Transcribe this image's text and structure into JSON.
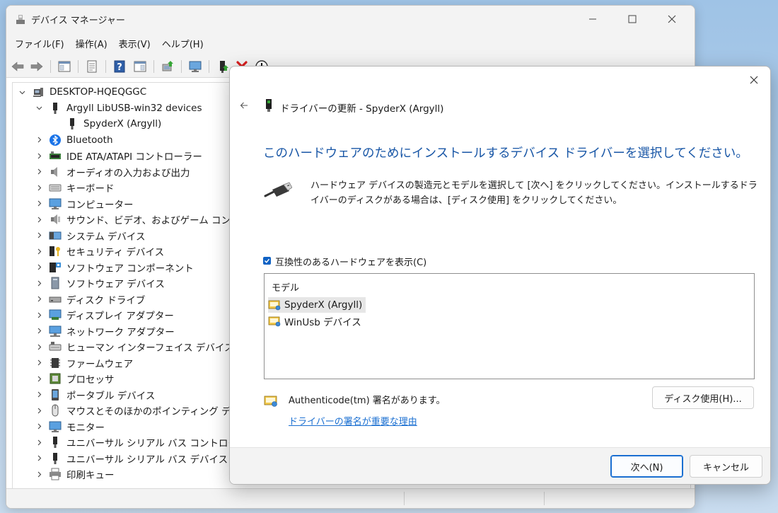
{
  "device_manager": {
    "title": "デバイス マネージャー",
    "menu": [
      "ファイル(F)",
      "操作(A)",
      "表示(V)",
      "ヘルプ(H)"
    ],
    "tree": {
      "root": "DESKTOP-HQEQGGC",
      "items": [
        {
          "label": "Argyll LibUSB-win32 devices",
          "icon": "usb-plug-icon",
          "expanded": true
        },
        {
          "label": "SpyderX (Argyll)",
          "icon": "usb-plug-icon",
          "child": true
        },
        {
          "label": "Bluetooth",
          "icon": "bluetooth-icon"
        },
        {
          "label": "IDE ATA/ATAPI コントローラー",
          "icon": "ide-controller-icon"
        },
        {
          "label": "オーディオの入力および出力",
          "icon": "speaker-icon"
        },
        {
          "label": "キーボード",
          "icon": "keyboard-icon"
        },
        {
          "label": "コンピューター",
          "icon": "computer-icon"
        },
        {
          "label": "サウンド、ビデオ、およびゲーム コントローラー",
          "icon": "sound-icon"
        },
        {
          "label": "システム デバイス",
          "icon": "system-device-icon"
        },
        {
          "label": "セキュリティ デバイス",
          "icon": "security-key-icon"
        },
        {
          "label": "ソフトウェア コンポーネント",
          "icon": "software-component-icon"
        },
        {
          "label": "ソフトウェア デバイス",
          "icon": "software-device-icon"
        },
        {
          "label": "ディスク ドライブ",
          "icon": "disk-drive-icon"
        },
        {
          "label": "ディスプレイ アダプター",
          "icon": "display-adapter-icon"
        },
        {
          "label": "ネットワーク アダプター",
          "icon": "network-adapter-icon"
        },
        {
          "label": "ヒューマン インターフェイス デバイス",
          "icon": "hid-icon"
        },
        {
          "label": "ファームウェア",
          "icon": "firmware-icon"
        },
        {
          "label": "プロセッサ",
          "icon": "processor-icon"
        },
        {
          "label": "ポータブル デバイス",
          "icon": "portable-device-icon"
        },
        {
          "label": "マウスとそのほかのポインティング デバイス",
          "icon": "mouse-icon"
        },
        {
          "label": "モニター",
          "icon": "monitor-icon"
        },
        {
          "label": "ユニバーサル シリアル バス コントローラー",
          "icon": "usb-plug-icon"
        },
        {
          "label": "ユニバーサル シリアル バス デバイス",
          "icon": "usb-plug-icon"
        },
        {
          "label": "印刷キュー",
          "icon": "printer-icon"
        }
      ]
    }
  },
  "dialog": {
    "header_title": "ドライバーの更新 - SpyderX (Argyll)",
    "heading": "このハードウェアのためにインストールするデバイス ドライバーを選択してください。",
    "description": "ハードウェア デバイスの製造元とモデルを選択して [次へ] をクリックしてください。インストールするドライバーのディスクがある場合は、[ディスク使用] をクリックしてください。",
    "compat_checkbox": {
      "label": "互換性のあるハードウェアを表示(C)",
      "checked": true
    },
    "list_header": "モデル",
    "models": [
      {
        "label": "SpyderX (Argyll)",
        "selected": true
      },
      {
        "label": "WinUsb デバイス",
        "selected": false
      }
    ],
    "authenticode": "Authenticode(tm) 署名があります。",
    "signing_link": "ドライバーの署名が重要な理由",
    "have_disk_button": "ディスク使用(H)...",
    "next_button": "次へ(N)",
    "cancel_button": "キャンセル"
  },
  "colors": {
    "heading_blue": "#1856a6",
    "link_blue": "#1a6fd1",
    "checkbox_blue": "#1062c4",
    "error_red": "#d81e1e"
  }
}
